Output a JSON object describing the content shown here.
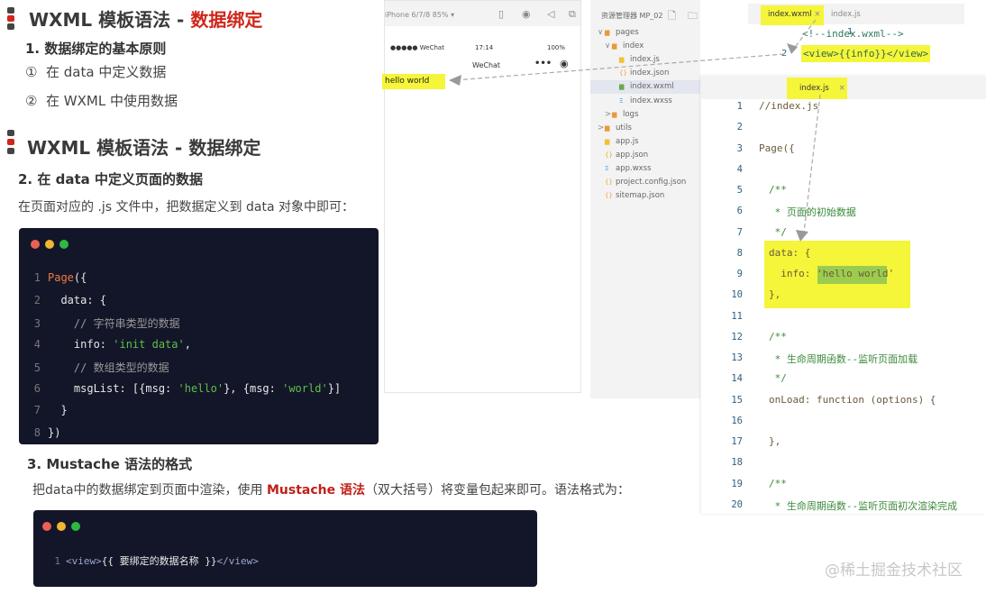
{
  "slide1": {
    "title_prefix": "WXML 模板语法 - ",
    "title_highlight": "数据绑定",
    "section": "1. 数据绑定的基本原则",
    "items": [
      {
        "num": "①",
        "text": "在 data 中定义数据"
      },
      {
        "num": "②",
        "text": "在 WXML 中使用数据"
      }
    ]
  },
  "slide2": {
    "title": "WXML 模板语法 - 数据绑定",
    "section": "2. 在 data 中定义页面的数据",
    "desc": "在页面对应的 .js 文件中，把数据定义到 data 对象中即可："
  },
  "code1": [
    {
      "n": "1",
      "parts": [
        {
          "c": "kw",
          "t": "Page"
        },
        {
          "c": "",
          "t": "({"
        }
      ]
    },
    {
      "n": "2",
      "parts": [
        {
          "c": "",
          "t": "  data: {"
        }
      ]
    },
    {
      "n": "3",
      "parts": [
        {
          "c": "cm",
          "t": "    // 字符串类型的数据"
        }
      ]
    },
    {
      "n": "4",
      "parts": [
        {
          "c": "",
          "t": "    info: "
        },
        {
          "c": "str",
          "t": "'init data'"
        },
        {
          "c": "",
          "t": ","
        }
      ]
    },
    {
      "n": "5",
      "parts": [
        {
          "c": "cm",
          "t": "    // 数组类型的数据"
        }
      ]
    },
    {
      "n": "6",
      "parts": [
        {
          "c": "",
          "t": "    msgList: [{msg: "
        },
        {
          "c": "str",
          "t": "'hello'"
        },
        {
          "c": "",
          "t": "}, {msg: "
        },
        {
          "c": "str",
          "t": "'world'"
        },
        {
          "c": "",
          "t": "}]"
        }
      ]
    },
    {
      "n": "7",
      "parts": [
        {
          "c": "",
          "t": "  }"
        }
      ]
    },
    {
      "n": "8",
      "parts": [
        {
          "c": "",
          "t": "})"
        }
      ]
    }
  ],
  "slide3": {
    "section": "3. Mustache 语法的格式",
    "desc_before": "把data中的数据绑定到页面中渲染，使用 ",
    "desc_highlight": "Mustache 语法",
    "desc_after": "（双大括号）将变量包起来即可。语法格式为："
  },
  "code2": {
    "n": "1",
    "open": "<view>",
    "body": "{{ 要绑定的数据名称 }}",
    "close": "</view>"
  },
  "simulator": {
    "device": "iPhone 6/7/8 85% ▾",
    "carrier": "●●●●● WeChat",
    "time": "17:14",
    "battery": "100%",
    "nav_title": "WeChat",
    "rendered_text": "hello world"
  },
  "explorer": {
    "title": "资源管理器 MP_02",
    "tree": [
      {
        "label": "pages",
        "icon": "folder-icon",
        "arrow": "∨",
        "indent": 0
      },
      {
        "label": "index",
        "icon": "folder-icon",
        "arrow": "∨",
        "indent": 1
      },
      {
        "label": "index.js",
        "icon": "js-file-icon",
        "arrow": "",
        "indent": 2
      },
      {
        "label": "index.json",
        "icon": "json-file-icon",
        "arrow": "",
        "indent": 2
      },
      {
        "label": "index.wxml",
        "icon": "wxml-file-icon",
        "arrow": "",
        "indent": 2,
        "selected": true
      },
      {
        "label": "index.wxss",
        "icon": "wxss-file-icon",
        "arrow": "",
        "indent": 2
      },
      {
        "label": "logs",
        "icon": "folder-icon",
        "arrow": ">",
        "indent": 1
      },
      {
        "label": "utils",
        "icon": "folder-icon",
        "arrow": ">",
        "indent": 0
      },
      {
        "label": "app.js",
        "icon": "js-file-icon",
        "arrow": "",
        "indent": 0
      },
      {
        "label": "app.json",
        "icon": "json-file-icon",
        "arrow": "",
        "indent": 0
      },
      {
        "label": "app.wxss",
        "icon": "wxss-file-icon",
        "arrow": "",
        "indent": 0
      },
      {
        "label": "project.config.json",
        "icon": "json-file-icon",
        "arrow": "",
        "indent": 0
      },
      {
        "label": "sitemap.json",
        "icon": "json-file-icon",
        "arrow": "",
        "indent": 0
      }
    ]
  },
  "wxml_editor": {
    "tabs": [
      "index.wxml",
      "index.js"
    ],
    "close": "×",
    "lines": [
      {
        "n": "1",
        "text": "<!--index.wxml-->"
      },
      {
        "n": "2",
        "text": "<view>{{info}}</view>"
      }
    ]
  },
  "js_editor": {
    "tab": "index.js",
    "close": "×",
    "lines": [
      {
        "n": "1",
        "text": "//index.js",
        "c": ""
      },
      {
        "n": "2",
        "text": "",
        "c": ""
      },
      {
        "n": "3",
        "text": "Page({",
        "c": ""
      },
      {
        "n": "4",
        "text": "",
        "c": ""
      },
      {
        "n": "5",
        "text": "/**",
        "c": "green"
      },
      {
        "n": "6",
        "text": " * 页面的初始数据",
        "c": "green"
      },
      {
        "n": "7",
        "text": " */",
        "c": "green"
      },
      {
        "n": "8",
        "text": "data: {",
        "c": ""
      },
      {
        "n": "9",
        "text": "  info: 'hello world'",
        "c": ""
      },
      {
        "n": "10",
        "text": "},",
        "c": ""
      },
      {
        "n": "11",
        "text": "",
        "c": ""
      },
      {
        "n": "12",
        "text": "/**",
        "c": "green"
      },
      {
        "n": "13",
        "text": " * 生命周期函数--监听页面加载",
        "c": "green"
      },
      {
        "n": "14",
        "text": " */",
        "c": "green"
      },
      {
        "n": "15",
        "text": "onLoad: function (options) {",
        "c": ""
      },
      {
        "n": "16",
        "text": "",
        "c": ""
      },
      {
        "n": "17",
        "text": "},",
        "c": ""
      },
      {
        "n": "18",
        "text": "",
        "c": ""
      },
      {
        "n": "19",
        "text": "/**",
        "c": "green"
      },
      {
        "n": "20",
        "text": " * 生命周期函数--监听页面初次渲染完成",
        "c": "green"
      }
    ]
  },
  "watermark": "@稀土掘金技术社区",
  "colors": {
    "accent_red": "#d0261b",
    "highlight_yellow": "#f5f53a",
    "code_bg": "#131628"
  }
}
